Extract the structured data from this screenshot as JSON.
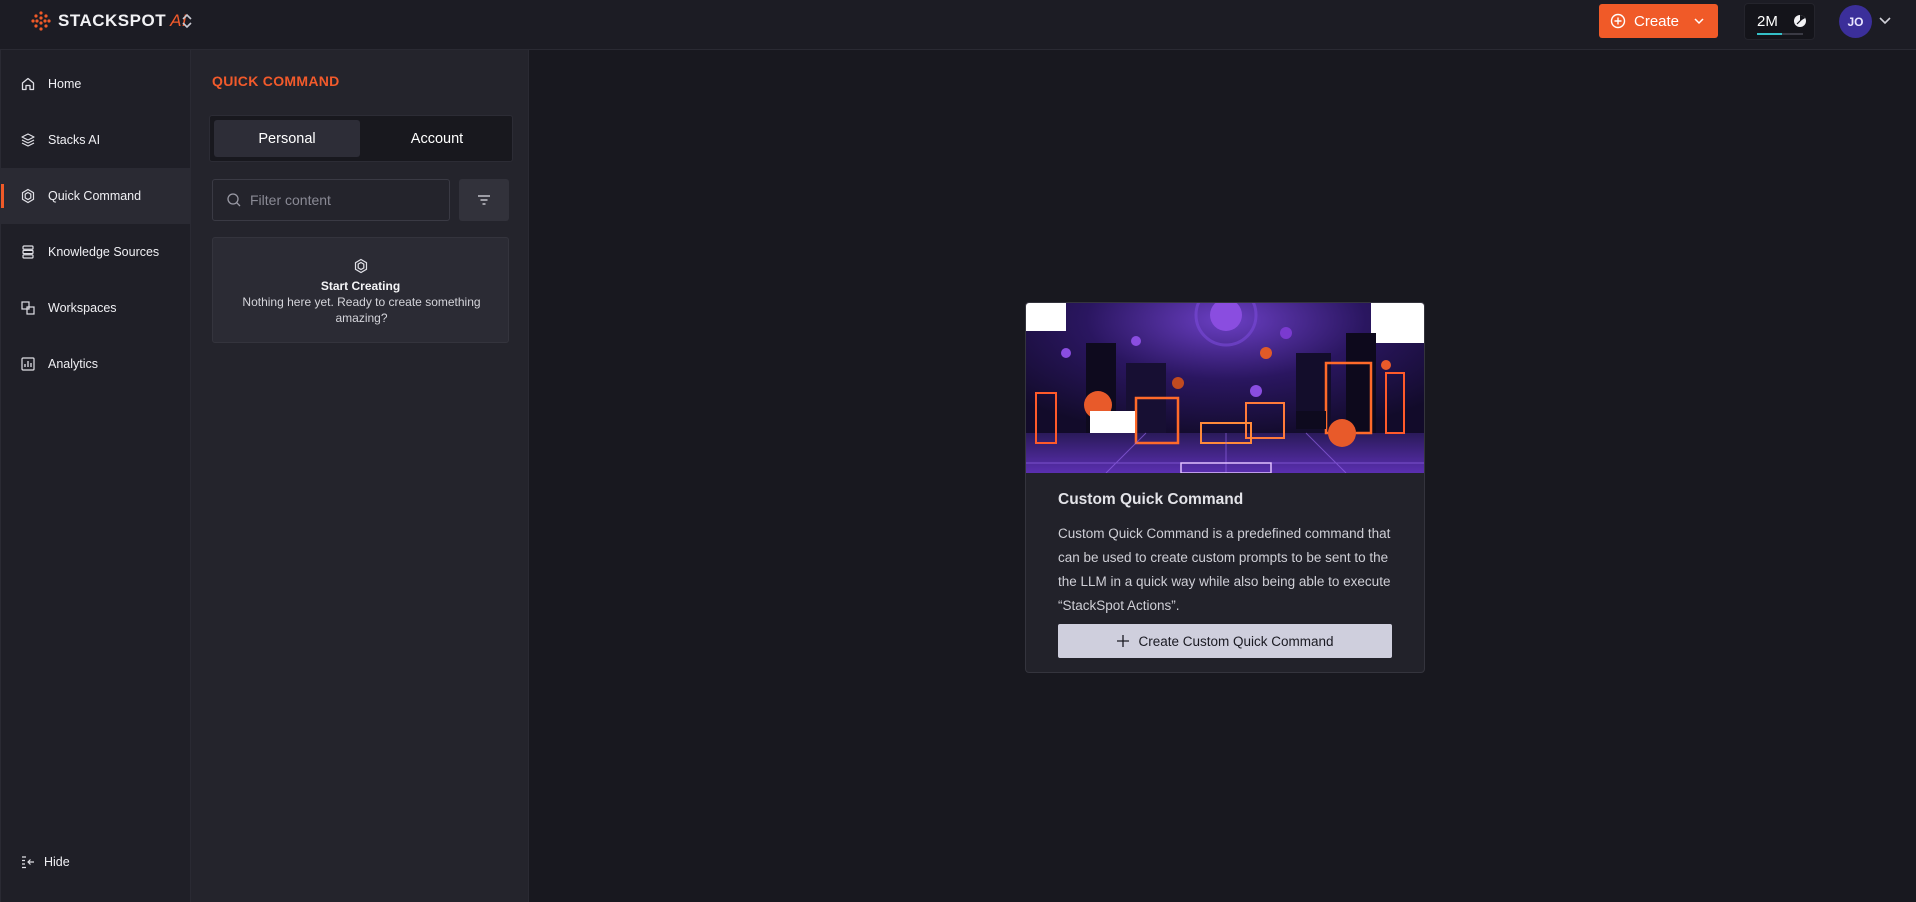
{
  "brand": {
    "name": "STACKSPOT",
    "suffix": "AI"
  },
  "topbar": {
    "create_label": "Create",
    "credits": {
      "value": "2M",
      "usage_fraction": 0.55
    },
    "avatar_initials": "JO"
  },
  "sidebar": {
    "items": [
      {
        "label": "Home",
        "icon": "home-icon"
      },
      {
        "label": "Stacks AI",
        "icon": "layers-icon"
      },
      {
        "label": "Quick Command",
        "icon": "hexagon-icon",
        "active": true
      },
      {
        "label": "Knowledge Sources",
        "icon": "database-icon"
      },
      {
        "label": "Workspaces",
        "icon": "workspaces-icon"
      },
      {
        "label": "Analytics",
        "icon": "chart-icon"
      }
    ],
    "hide_label": "Hide"
  },
  "panel": {
    "title": "QUICK COMMAND",
    "tabs": [
      {
        "label": "Personal",
        "selected": true
      },
      {
        "label": "Account",
        "selected": false
      }
    ],
    "search_placeholder": "Filter content",
    "empty": {
      "title": "Start Creating",
      "text": "Nothing here yet. Ready to create something amazing?"
    }
  },
  "info_card": {
    "title": "Custom Quick Command",
    "description": "Custom Quick Command is a predefined command that can be used to create custom prompts to be sent to the the LLM in a quick way while also being able to execute “StackSpot Actions”.",
    "button_label": "Create Custom Quick Command"
  },
  "colors": {
    "accent": "#f05a28",
    "background": "#18181f",
    "sidebar": "#1f1f27",
    "panel": "#24242c"
  }
}
